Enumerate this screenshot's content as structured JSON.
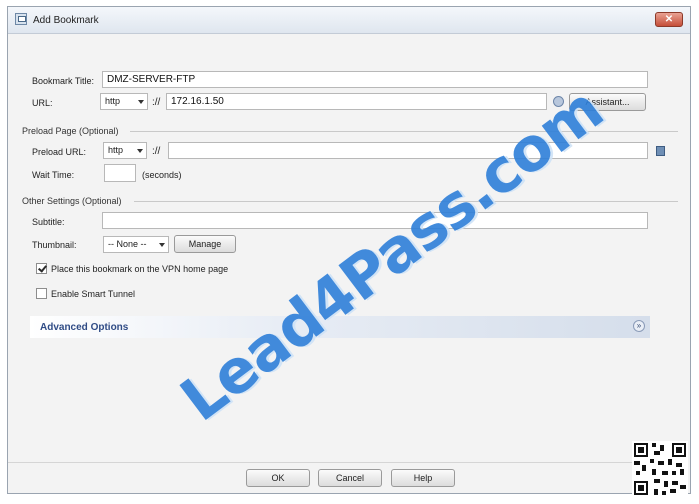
{
  "window": {
    "title": "Add Bookmark",
    "close_glyph": "✕"
  },
  "bookmark": {
    "title_label": "Bookmark Title:",
    "title_value": "DMZ-SERVER-FTP",
    "url_label": "URL:",
    "url_protocol": "http",
    "url_separator": "://",
    "url_value": "172.16.1.50",
    "assistant_label": "Assistant..."
  },
  "preload": {
    "section_title": "Preload Page (Optional)",
    "url_label": "Preload URL:",
    "url_protocol": "http",
    "url_separator": "://",
    "url_value": "",
    "wait_label": "Wait Time:",
    "wait_value": "",
    "wait_unit": "(seconds)"
  },
  "other": {
    "section_title": "Other Settings (Optional)",
    "subtitle_label": "Subtitle:",
    "subtitle_value": "",
    "thumbnail_label": "Thumbnail:",
    "thumbnail_value": "-- None --",
    "manage_label": "Manage",
    "vpn_home_label": "Place this bookmark on the VPN home page",
    "vpn_home_checked": true,
    "smart_tunnel_label": "Enable Smart Tunnel",
    "smart_tunnel_checked": false
  },
  "advanced": {
    "label": "Advanced Options",
    "expand_glyph": "»"
  },
  "footer": {
    "ok_label": "OK",
    "cancel_label": "Cancel",
    "help_label": "Help"
  },
  "watermark": {
    "text": "Lead4Pass.com"
  },
  "colors": {
    "accent": "#2f4b85",
    "watermark": "#2e7fd9",
    "close": "#c54e38"
  }
}
